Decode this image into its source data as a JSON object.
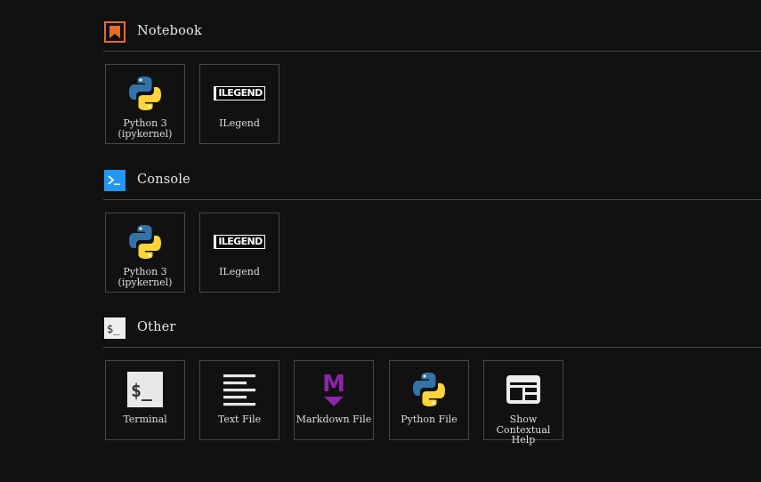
{
  "sections": {
    "notebook": {
      "title": "Notebook",
      "icon": "notebook-bookmark-icon",
      "items": [
        {
          "label": "Python 3\n(ipykernel)",
          "icon": "python-logo-icon"
        },
        {
          "label": "ILegend",
          "icon": "ilegend-logo-icon",
          "logo_text": "ILEGEND"
        }
      ]
    },
    "console": {
      "title": "Console",
      "icon": "console-prompt-icon",
      "items": [
        {
          "label": "Python 3\n(ipykernel)",
          "icon": "python-logo-icon"
        },
        {
          "label": "ILegend",
          "icon": "ilegend-logo-icon",
          "logo_text": "ILEGEND"
        }
      ]
    },
    "other": {
      "title": "Other",
      "icon": "terminal-dollar-icon",
      "items": [
        {
          "label": "Terminal",
          "icon": "terminal-icon"
        },
        {
          "label": "Text File",
          "icon": "text-file-icon"
        },
        {
          "label": "Markdown File",
          "icon": "markdown-icon"
        },
        {
          "label": "Python File",
          "icon": "python-logo-icon"
        },
        {
          "label": "Show\nContextual Help",
          "icon": "contextual-help-icon"
        }
      ]
    }
  },
  "colors": {
    "background": "#111111",
    "notebook_accent": "#e46e2e",
    "console_accent": "#2196f3",
    "markdown_accent": "#7b1fa2",
    "python_blue": "#3572a5",
    "python_yellow": "#ffd43b"
  }
}
